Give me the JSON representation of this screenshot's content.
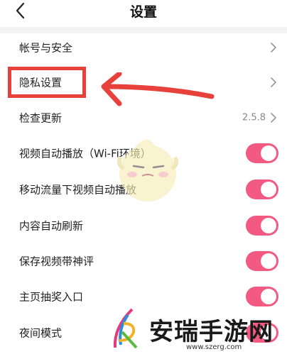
{
  "header": {
    "title": "设置",
    "back_icon": "chevron-left-icon"
  },
  "settings": {
    "items": [
      {
        "label": "帐号与安全",
        "control": "chevron"
      },
      {
        "label": "隐私设置",
        "control": "chevron"
      },
      {
        "label": "检查更新",
        "control": "chevron",
        "value": "2.5.8"
      },
      {
        "label": "视频自动播放（Wi-Fi环境）",
        "control": "toggle",
        "on": true
      },
      {
        "label": "移动流量下视频自动播放",
        "control": "toggle",
        "on": true
      },
      {
        "label": "内容自动刷新",
        "control": "toggle",
        "on": true
      },
      {
        "label": "保存视频带神评",
        "control": "toggle",
        "on": true
      },
      {
        "label": "主页抽奖入口",
        "control": "toggle",
        "on": true
      },
      {
        "label": "夜间模式",
        "control": "toggle",
        "on": true
      }
    ]
  },
  "colors": {
    "toggle_on": "#f25a82",
    "annotation_red": "#e8413b"
  },
  "watermark": {
    "text": "安瑞手游网",
    "url": "www.szerg.com"
  }
}
